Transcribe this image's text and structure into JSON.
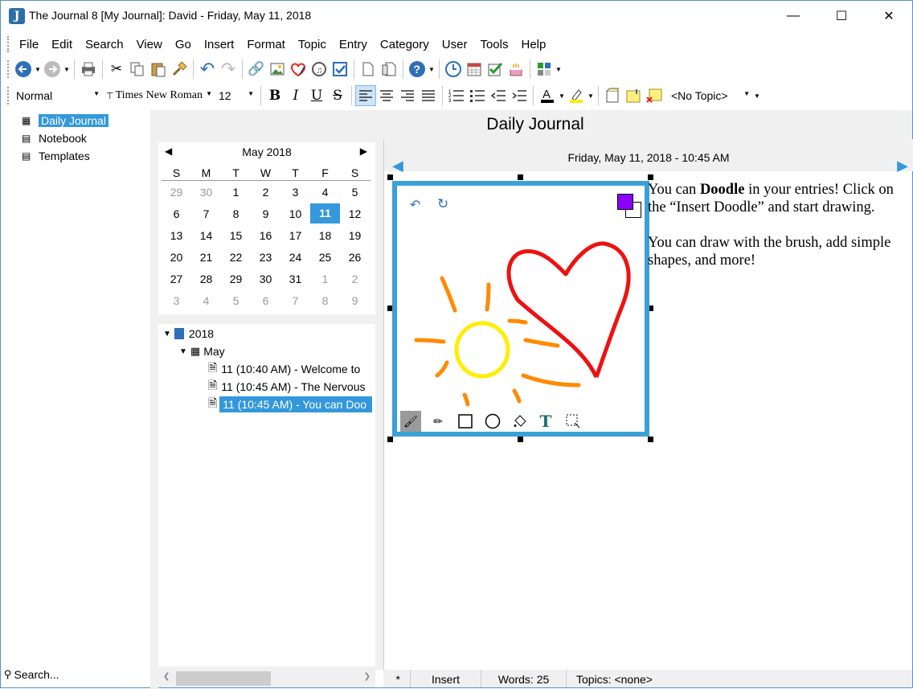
{
  "window": {
    "title": "The Journal 8 [My Journal]: David - Friday, May 11, 2018"
  },
  "menu": [
    "File",
    "Edit",
    "Search",
    "View",
    "Go",
    "Insert",
    "Format",
    "Topic",
    "Entry",
    "Category",
    "User",
    "Tools",
    "Help"
  ],
  "format_bar": {
    "style": "Normal",
    "font": "Times New Roman",
    "size": "12",
    "topic": "<No Topic>"
  },
  "left_tree": {
    "items": [
      "Daily Journal",
      "Notebook",
      "Templates"
    ],
    "selected": "Daily Journal"
  },
  "search": {
    "placeholder": "Search..."
  },
  "header": {
    "title": "Daily Journal"
  },
  "calendar": {
    "month": "May 2018",
    "dow": [
      "S",
      "M",
      "T",
      "W",
      "T",
      "F",
      "S"
    ],
    "weeks": [
      [
        "29",
        "30",
        "1",
        "2",
        "3",
        "4",
        "5"
      ],
      [
        "6",
        "7",
        "8",
        "9",
        "10",
        "11",
        "12"
      ],
      [
        "13",
        "14",
        "15",
        "16",
        "17",
        "18",
        "19"
      ],
      [
        "20",
        "21",
        "22",
        "23",
        "24",
        "25",
        "26"
      ],
      [
        "27",
        "28",
        "29",
        "30",
        "31",
        "1",
        "2"
      ],
      [
        "3",
        "4",
        "5",
        "6",
        "7",
        "8",
        "9"
      ]
    ],
    "today": "11"
  },
  "entries": {
    "year": "2018",
    "month": "May",
    "items": [
      "11 (10:40 AM) - Welcome to",
      "11 (10:45 AM) - The Nervous",
      "11 (10:45 AM) - You can Doo"
    ],
    "selected_index": 2
  },
  "editor": {
    "date": "Friday, May 11, 2018 - 10:45 AM",
    "p1_pre": "You can ",
    "p1_bold": "Doodle",
    "p1_post": " in your entries! Click on the “Insert Doodle” and start drawing.",
    "p2": "You can draw with the brush, add simple shapes, and more!"
  },
  "doodle": {
    "primary_color": "#8b00ff",
    "secondary_color": "#ffffff"
  },
  "status": {
    "modified": "*",
    "mode": "Insert",
    "words": "Words: 25",
    "topics": "Topics: <none>"
  },
  "colors": {
    "accent": "#3498db",
    "doodle_border": "#3ca0d8",
    "heart": "#ee1111",
    "sun": "#ffee00",
    "rays": "#ff8a00"
  }
}
